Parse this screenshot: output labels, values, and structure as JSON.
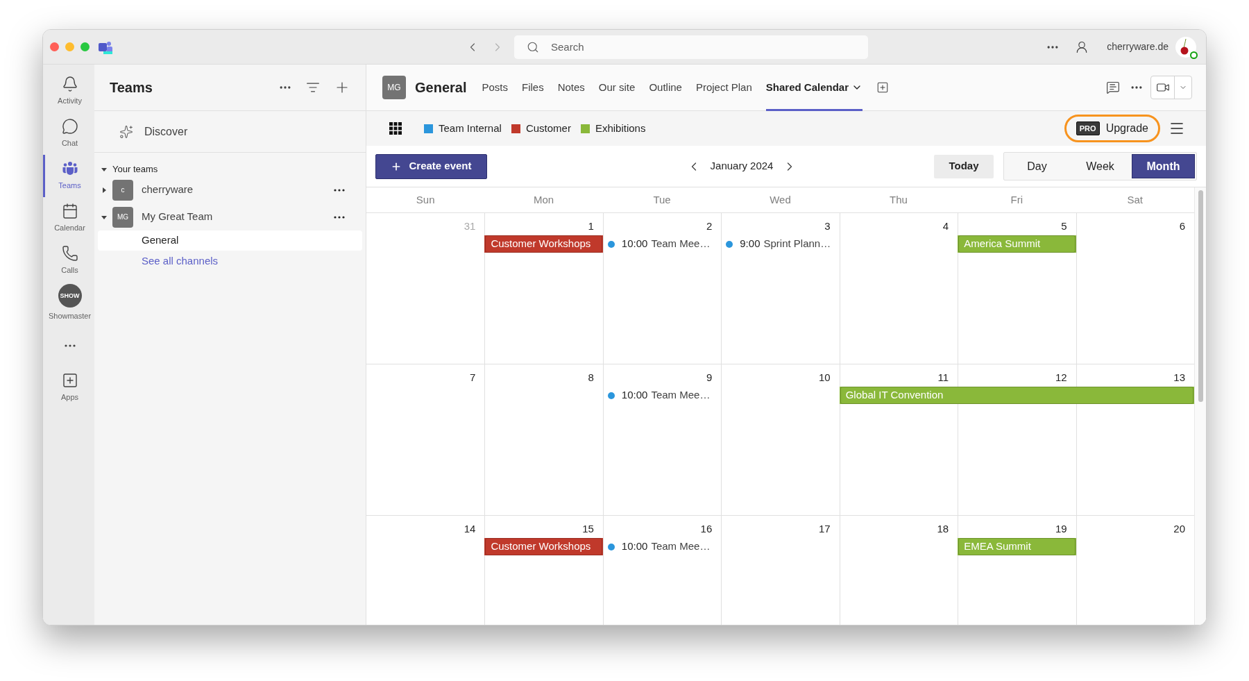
{
  "titlebar": {
    "search": {
      "placeholder": "Search"
    },
    "account": "cherryware.de",
    "status_online": true
  },
  "rail": [
    {
      "kind": "bell",
      "label": "Activity",
      "selected": false
    },
    {
      "kind": "chat",
      "label": "Chat",
      "selected": false
    },
    {
      "kind": "teams",
      "label": "Teams",
      "selected": true
    },
    {
      "kind": "calendar",
      "label": "Calendar",
      "selected": false
    },
    {
      "kind": "phone",
      "label": "Calls",
      "selected": false
    },
    {
      "kind": "app",
      "badge": "SHOW",
      "label": "Showmaster",
      "selected": false
    },
    {
      "kind": "more",
      "selected": false
    },
    {
      "kind": "apps",
      "label": "Apps",
      "selected": false
    }
  ],
  "teams_panel": {
    "title": "Teams",
    "discover": "Discover",
    "section": {
      "label": "Your teams",
      "expanded": true,
      "teams": [
        {
          "avatar": "c",
          "name": "cherryware",
          "expanded": false
        },
        {
          "avatar": "MG",
          "name": "My Great Team",
          "expanded": true,
          "channels": [
            {
              "name": "General",
              "selected": true
            }
          ],
          "link": "See all channels"
        }
      ]
    }
  },
  "channel": {
    "avatar": "MG",
    "title": "General",
    "tabs": [
      {
        "label": "Posts",
        "selected": false
      },
      {
        "label": "Files",
        "selected": false
      },
      {
        "label": "Notes",
        "selected": false
      },
      {
        "label": "Our site",
        "selected": false
      },
      {
        "label": "Outline",
        "selected": false
      },
      {
        "label": "Project Plan",
        "selected": false
      },
      {
        "label": "Shared Calendar",
        "selected": true
      }
    ]
  },
  "legend": [
    {
      "label": "Team Internal",
      "color": "#2b96dc"
    },
    {
      "label": "Customer",
      "color": "#c0392b"
    },
    {
      "label": "Exhibitions",
      "color": "#8ab83a"
    }
  ],
  "upgrade": {
    "badge": "PRO",
    "label": "Upgrade",
    "highlighted": true
  },
  "toolbar": {
    "create": "Create event",
    "month": "January 2024",
    "today": "Today",
    "views": [
      {
        "label": "Day",
        "selected": false
      },
      {
        "label": "Week",
        "selected": false
      },
      {
        "label": "Month",
        "selected": true
      }
    ]
  },
  "weekdays": [
    "Sun",
    "Mon",
    "Tue",
    "Wed",
    "Thu",
    "Fri",
    "Sat"
  ],
  "weeks": [
    {
      "days": [
        {
          "number": "31",
          "muted": true
        },
        {
          "number": "1",
          "muted": false,
          "events": [
            {
              "kind": "bar",
              "title": "Customer Workshops",
              "color": "#c0392b"
            }
          ]
        },
        {
          "number": "2",
          "muted": false,
          "events": [
            {
              "kind": "timed",
              "time": "10:00",
              "title": "Team Mee…",
              "color": "#2b96dc"
            }
          ]
        },
        {
          "number": "3",
          "muted": false,
          "events": [
            {
              "kind": "timed",
              "time": "9:00",
              "title": "Sprint Plann…",
              "color": "#2b96dc"
            }
          ]
        },
        {
          "number": "4",
          "muted": false
        },
        {
          "number": "5",
          "muted": false,
          "events": [
            {
              "kind": "bar",
              "title": "America Summit",
              "color": "#8ab83a"
            }
          ]
        },
        {
          "number": "6",
          "muted": false
        }
      ]
    },
    {
      "days": [
        {
          "number": "7",
          "muted": false
        },
        {
          "number": "8",
          "muted": false
        },
        {
          "number": "9",
          "muted": false,
          "events": [
            {
              "kind": "timed",
              "time": "10:00",
              "title": "Team Mee…",
              "color": "#2b96dc"
            }
          ]
        },
        {
          "number": "10",
          "muted": false
        },
        {
          "number": "11",
          "muted": false,
          "events": [
            {
              "kind": "bar",
              "title": "Global IT Convention",
              "color": "#8ab83a"
            }
          ]
        },
        {
          "number": "12",
          "muted": false,
          "events": [
            {
              "kind": "continued"
            }
          ]
        },
        {
          "number": "13",
          "muted": false,
          "events": [
            {
              "kind": "continued"
            }
          ]
        }
      ]
    },
    {
      "days": [
        {
          "number": "14",
          "muted": false
        },
        {
          "number": "15",
          "muted": false,
          "events": [
            {
              "kind": "bar",
              "title": "Customer Workshops",
              "color": "#c0392b"
            }
          ]
        },
        {
          "number": "16",
          "muted": false,
          "events": [
            {
              "kind": "timed",
              "time": "10:00",
              "title": "Team Mee…",
              "color": "#2b96dc"
            }
          ]
        },
        {
          "number": "17",
          "muted": false
        },
        {
          "number": "18",
          "muted": false
        },
        {
          "number": "19",
          "muted": false,
          "events": [
            {
              "kind": "bar",
              "title": "EMEA Summit",
              "color": "#8ab83a"
            }
          ]
        },
        {
          "number": "20",
          "muted": false
        }
      ]
    }
  ]
}
